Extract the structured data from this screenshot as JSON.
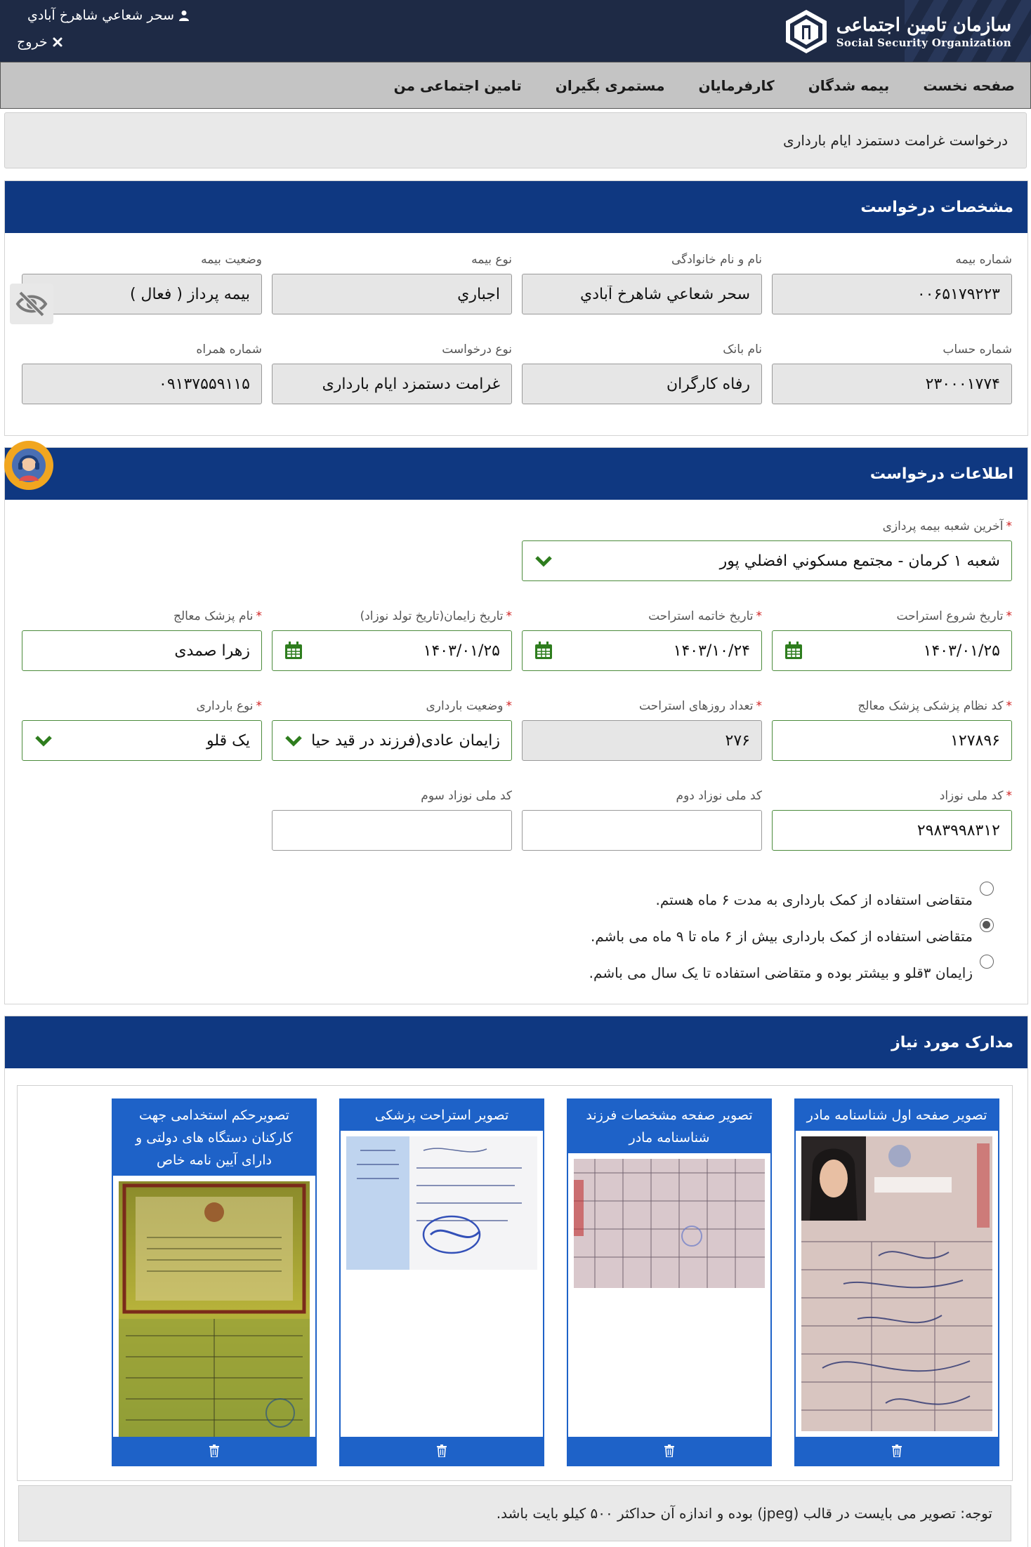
{
  "header": {
    "org_name_fa": "سازمان تامین اجتماعی",
    "org_name_en": "Social Security Organization",
    "user_name": "سحر شعاعي شاهرخ آبادي",
    "logout_label": "خروج"
  },
  "nav": {
    "items": [
      "صفحه نخست",
      "بیمه شدگان",
      "کارفرمایان",
      "مستمری بگیران",
      "تامین اجتماعی من"
    ]
  },
  "breadcrumb": "درخواست غرامت دستمزد ایام بارداری",
  "request_spec": {
    "title": "مشخصات درخواست",
    "insurance_number_label": "شماره بیمه",
    "insurance_number": "۰۰۶۵۱۷۹۲۲۳",
    "full_name_label": "نام و نام خانوادگی",
    "full_name": "سحر شعاعي شاهرخ آبادي",
    "insurance_type_label": "نوع بیمه",
    "insurance_type": "اجباري",
    "insurance_status_label": "وضعیت بیمه",
    "insurance_status": "بیمه پرداز ( فعال )",
    "account_number_label": "شماره حساب",
    "account_number": "۲۳۰۰۰۱۷۷۴",
    "bank_name_label": "نام بانک",
    "bank_name": "رفاه کارگران",
    "request_type_label": "نوع درخواست",
    "request_type": "غرامت دستمزد ایام بارداری",
    "mobile_label": "شماره همراه",
    "mobile": "۰۹۱۳۷۵۵۹۱۱۵"
  },
  "request_info": {
    "title": "اطلاعات درخواست",
    "last_branch_label": "آخرین شعبه بیمه پردازی",
    "last_branch": "شعبه ۱ کرمان - مجتمع مسکوني افضلي پور",
    "rest_start_label": "تاریخ شروع استراحت",
    "rest_start": "۱۴۰۳/۰۱/۲۵",
    "rest_end_label": "تاریخ خاتمه استراحت",
    "rest_end": "۱۴۰۳/۱۰/۲۴",
    "birth_date_label": "تاریخ زایمان(تاریخ تولد نوزاد)",
    "birth_date": "۱۴۰۳/۰۱/۲۵",
    "doctor_name_label": "نام پزشک معالج",
    "doctor_name": "زهرا صمدی",
    "doctor_code_label": "کد نظام پزشکی پزشک معالج",
    "doctor_code": "۱۲۷۸۹۶",
    "rest_days_label": "تعداد روزهای استراحت",
    "rest_days": "۲۷۶",
    "pregnancy_status_label": "وضعیت بارداری",
    "pregnancy_status": "زایمان عادی(فرزند در قید حیات)",
    "pregnancy_type_label": "نوع بارداری",
    "pregnancy_type": "یک قلو",
    "baby_id_label": "کد ملی نوزاد",
    "baby_id": "۲۹۸۳۹۹۸۳۱۲",
    "baby2_id_label": "کد ملی نوزاد دوم",
    "baby2_id": "",
    "baby3_id_label": "کد ملی نوزاد سوم",
    "baby3_id": "",
    "options": [
      "متقاضی استفاده از کمک بارداری به مدت ۶ ماه هستم.",
      "متقاضی استفاده از کمک بارداری بیش از ۶ ماه تا ۹ ماه می باشم.",
      "زایمان ۳قلو و بیشتر بوده و متقاضی استفاده تا یک سال می باشم."
    ],
    "selected_option": 1
  },
  "documents": {
    "title": "مدارک مورد نیاز",
    "items": [
      "تصویر صفحه اول شناسنامه مادر",
      "تصویر صفحه مشخصات فرزند شناسنامه مادر",
      "تصویر استراحت پزشکی",
      "تصویرحکم استخدامی جهت کارکنان دستگاه های دولتی و دارای آیین نامه خاص"
    ]
  },
  "note": "توجه: تصویر می بایست در قالب (jpeg) بوده و اندازه آن حداکثر ۵۰۰ کیلو بایت باشد.",
  "colors": {
    "header_bg": "#1e2a45",
    "panel_head": "#0f3881",
    "doc_blue": "#1e62c8",
    "valid_green": "#4b8b3b",
    "required_red": "#d01f1f"
  }
}
